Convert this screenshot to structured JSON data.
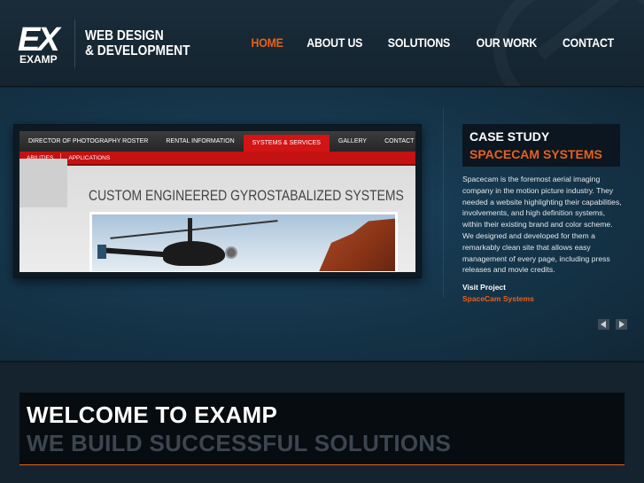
{
  "header": {
    "logo_ex": "EX",
    "logo_sub": "EXAMP",
    "tagline_line1": "WEB DESIGN",
    "tagline_line2": "& DEVELOPMENT"
  },
  "nav": {
    "items": [
      {
        "label": "HOME",
        "active": true
      },
      {
        "label": "ABOUT US",
        "active": false
      },
      {
        "label": "SOLUTIONS",
        "active": false
      },
      {
        "label": "OUR WORK",
        "active": false
      },
      {
        "label": "CONTACT",
        "active": false
      }
    ]
  },
  "slide": {
    "screenshot": {
      "nav": [
        "DIRECTOR OF PHOTOGRAPHY ROSTER",
        "RENTAL INFORMATION",
        "SYSTEMS & SERVICES",
        "GALLERY",
        "CONTACT"
      ],
      "subnav": [
        "ABILITIES",
        "APPLICATIONS"
      ],
      "heading": "CUSTOM ENGINEERED GYROSTABALIZED SYSTEMS"
    },
    "case_label": "CASE STUDY",
    "case_title": "SPACECAM SYSTEMS",
    "description": "Spacecam is the foremost aerial imaging company in the motion picture industry. They needed a website highlighting their capabilities, involvements, and high definition systems, within their existing brand and color scheme. We designed and developed for them a remarkably clean site that allows easy management of every page, including press releases and movie credits.",
    "visit_label": "Visit Project",
    "visit_link": "SpaceCam Systems"
  },
  "welcome": {
    "title": "WELCOME TO EXAMP",
    "subtitle": "WE BUILD SUCCESSFUL SOLUTIONS"
  },
  "colors": {
    "accent": "#e8601c",
    "background": "#12222f",
    "welcome_box": "#070c10"
  },
  "icons": {
    "prev": "arrow-left-icon",
    "next": "arrow-right-icon"
  }
}
